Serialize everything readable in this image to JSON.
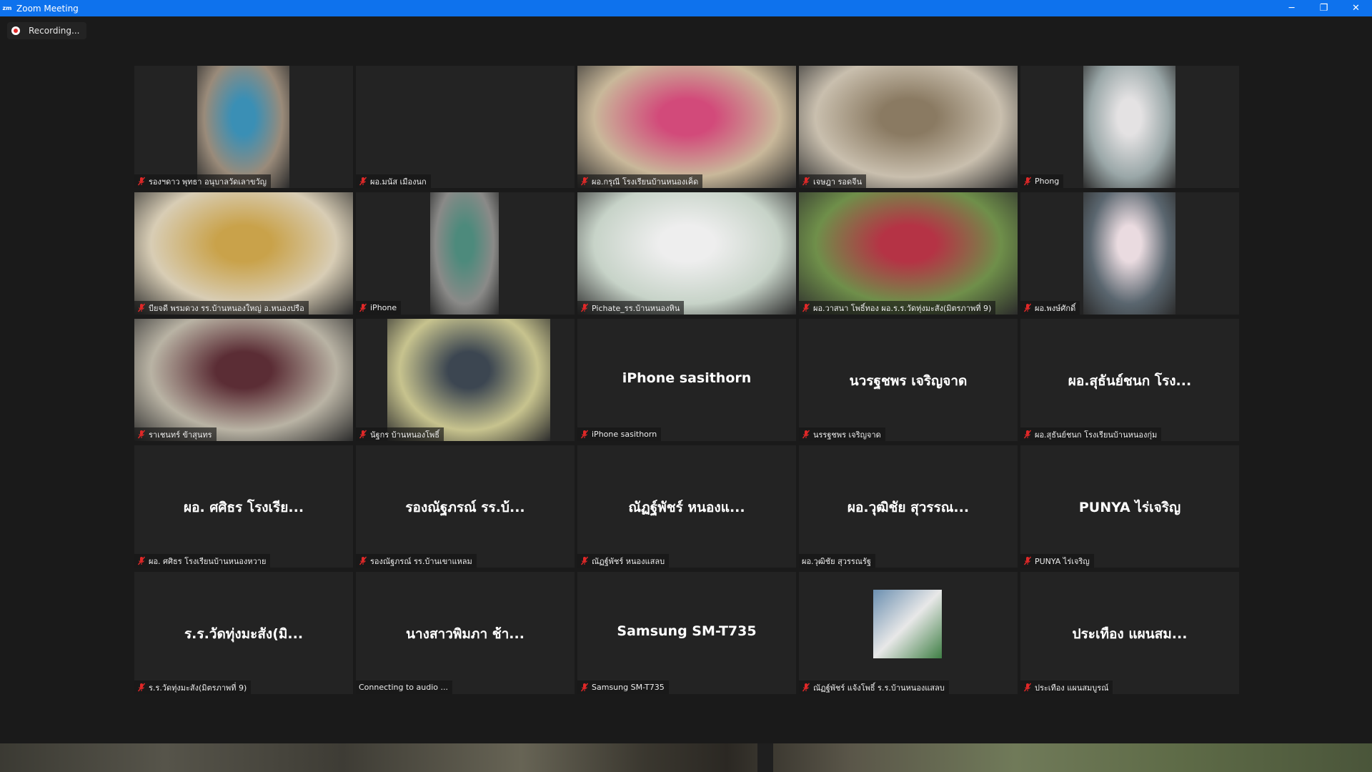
{
  "window": {
    "title": "Zoom Meeting",
    "app_icon_text": "zm",
    "minimize": "─",
    "restore": "❐",
    "close": "✕"
  },
  "recording": {
    "label": "Recording..."
  },
  "colors": {
    "titlebar": "#0e72ed",
    "tile_bg": "#232323",
    "muted_red": "#e02828"
  },
  "participants": [
    {
      "name": "รองฯดาว พุทธา อนุบาลวัดเลาขวัญ",
      "muted": true,
      "display": "video",
      "video_style": "narrow",
      "c1": "#9a8b7a",
      "c2": "#3a8fb5"
    },
    {
      "name": "ผอ.มนัส เมืองนก",
      "muted": true,
      "display": "blank"
    },
    {
      "name": "ผอ.กรุณี โรงเรียนบ้านหนองเค็ด",
      "muted": true,
      "display": "video",
      "video_style": "full",
      "c1": "#c9b89a",
      "c2": "#d24a7a"
    },
    {
      "name": "เจษฎา รอดจีน",
      "muted": true,
      "display": "video",
      "video_style": "full",
      "c1": "#c9bfae",
      "c2": "#8a7a62"
    },
    {
      "name": "Phong",
      "muted": true,
      "display": "video",
      "video_style": "narrow",
      "c1": "#9aa7a8",
      "c2": "#e4e2e3"
    },
    {
      "name": "บียจดี พรมดวง รร.บ้านหนองใหญ่ อ.หนองปรือ",
      "muted": true,
      "display": "video",
      "video_style": "full",
      "c1": "#d8cdb5",
      "c2": "#c9a24a"
    },
    {
      "name": "iPhone",
      "muted": true,
      "display": "video",
      "video_style": "narrow2",
      "c1": "#8a8a88",
      "c2": "#4d8a7c"
    },
    {
      "name": "Pichate_รร.บ้านหนองหิน",
      "muted": true,
      "display": "video",
      "video_style": "full",
      "c1": "#c7d3c8",
      "c2": "#eeeeee"
    },
    {
      "name": "ผอ.วาสนา โพธิ์ทอง ผอ.ร.ร.วัดทุ่งมะสัง(มิตรภาพที่ 9)",
      "muted": true,
      "display": "video",
      "video_style": "full",
      "c1": "#6f8f4a",
      "c2": "#b53345"
    },
    {
      "name": "ผอ.พงษ์ศักดิ์",
      "muted": true,
      "display": "video",
      "video_style": "narrow",
      "c1": "#5a666f",
      "c2": "#eadbe0"
    },
    {
      "name": "ราเชนทร์ ข้าสุนทร",
      "muted": true,
      "display": "video",
      "video_style": "full",
      "c1": "#b9b3a4",
      "c2": "#5b2d35"
    },
    {
      "name": "นัฐกร บ้านหนองโพธิ์",
      "muted": true,
      "display": "video",
      "video_style": "medium",
      "c1": "#c7c38e",
      "c2": "#3c4651"
    },
    {
      "name": "iPhone sasithorn",
      "muted": true,
      "display": "text",
      "big_name": "iPhone sasithorn"
    },
    {
      "name": "นรรฐชพร เจริญจาด",
      "muted": true,
      "display": "text",
      "big_name": "นวรฐชพร เจริญจาด"
    },
    {
      "name": "ผอ.สุธันย์ชนก โรงเรียนบ้านหนองกุ่ม",
      "muted": true,
      "display": "text",
      "big_name": "ผอ.สุธันย์ชนก โรง..."
    },
    {
      "name": "ผอ. ศศิธร โรงเรียนบ้านหนองหวาย",
      "muted": true,
      "display": "text",
      "big_name": "ผอ. ศศิธร โรงเรีย..."
    },
    {
      "name": "รองณัฐภรณ์ รร.บ้านเขาแหลม",
      "muted": true,
      "display": "text",
      "big_name": "รองณัฐภรณ์ รร.บ้..."
    },
    {
      "name": "ณัฏฐ์พัชร์ หนองแสลบ",
      "muted": true,
      "display": "text",
      "big_name": "ณัฏฐ์พัชร์ หนองแ..."
    },
    {
      "name": "ผอ.วุฒิชัย สุวรรณรัฐ",
      "muted": false,
      "display": "text",
      "big_name": "ผอ.วุฒิชัย สุวรรณ..."
    },
    {
      "name": "PUNYA ไร่เจริญ",
      "muted": true,
      "display": "text",
      "big_name": "PUNYA ไร่เจริญ"
    },
    {
      "name": "ร.ร.วัดทุ่งมะสัง(มิตรภาพที่ 9)",
      "muted": true,
      "display": "text",
      "big_name": "ร.ร.วัดทุ่งมะสัง(มิ..."
    },
    {
      "name": "Connecting to audio ...",
      "muted": false,
      "display": "text",
      "big_name": "นางสาวพิมภา ช้า..."
    },
    {
      "name": "Samsung SM-T735",
      "muted": true,
      "display": "text",
      "big_name": "Samsung SM-T735"
    },
    {
      "name": "ณัฏฐ์พัชร์ แจ้งโพธิ์ ร.ร.บ้านหนองแสลบ",
      "muted": true,
      "display": "avatar",
      "c1": "#6b8fb0",
      "c2": "#3f7f45"
    },
    {
      "name": "ประเทือง แผนสมบูรณ์",
      "muted": true,
      "display": "text",
      "big_name": "ประเทือง แผนสม..."
    }
  ]
}
